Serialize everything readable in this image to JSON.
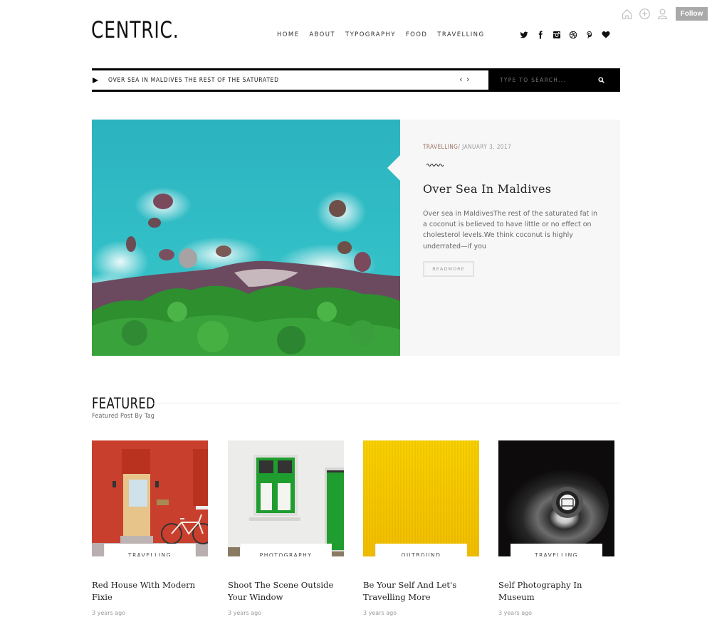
{
  "toolbar": {
    "icons": [
      "home-icon",
      "add-icon",
      "user-icon"
    ],
    "follow_label": "Follow"
  },
  "header": {
    "logo": "CENTRIC.",
    "nav": [
      "HOME",
      "ABOUT",
      "TYPOGRAPHY",
      "FOOD",
      "TRAVELLING"
    ],
    "social": [
      "twitter-icon",
      "facebook-icon",
      "instagram-icon",
      "dribbble-icon",
      "pinterest-icon",
      "heart-icon"
    ]
  },
  "ticker": {
    "text": "OVER SEA IN MALDIVES THE REST OF THE SATURATED",
    "prev": "‹",
    "next": "›"
  },
  "search": {
    "placeholder": "TYPE TO SEARCH...",
    "value": ""
  },
  "hero": {
    "category": "TRAVELLING/",
    "date": " JANUARY 3, 2017",
    "title": "Over Sea In Maldives",
    "excerpt": "Over sea in MaldivesThe rest of the saturated fat in a coconut is believed to have little or no effect on cholesterol levels.We think coconut is highly underrated—if you",
    "readmore_label": "READMORE"
  },
  "featured": {
    "title": "FEATURED",
    "subtitle": "Featured Post By Tag",
    "cards": [
      {
        "tag": "TRAVELLING",
        "title": "Red House With Modern Fixie",
        "date": "3 years ago"
      },
      {
        "tag": "PHOTOGRAPHY",
        "title": "Shoot The Scene Outside Your Window",
        "date": "3 years ago"
      },
      {
        "tag": "OUTBOUND",
        "title": "Be Your Self And Let's Travelling More",
        "date": "3 years ago"
      },
      {
        "tag": "TRAVELLING",
        "title": "Self Photography In Museum",
        "date": "3 years ago"
      }
    ]
  },
  "colors": {
    "accent_category": "#9a6f60",
    "panel_bg": "#f7f7f7",
    "follow_bg": "#a9a9a9",
    "search_bg": "#000000"
  }
}
